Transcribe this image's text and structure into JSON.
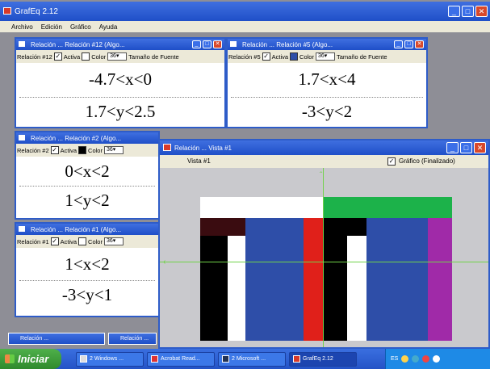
{
  "app": {
    "title": "GrafEq 2.12",
    "menu": [
      "Archivo",
      "Edición",
      "Gráfico",
      "Ayuda"
    ]
  },
  "relation_windows": [
    {
      "title": "Relación ... Relación #12 (Algo...",
      "relation": "Relación #12",
      "active_label": "Activa",
      "color_label": "Color",
      "color": "#ffffff",
      "size": "36",
      "size_label": "Tamaño de Fuente",
      "lines": [
        "-4.7<x<0",
        "1.7<y<2.5"
      ]
    },
    {
      "title": "Relación ... Relación #5 (Algo...",
      "relation": "Relación #5",
      "active_label": "Activa",
      "color_label": "Color",
      "color": "#2e4ea8",
      "size": "36",
      "size_label": "Tamaño de Fuente",
      "lines": [
        "1.7<x<4",
        "-3<y<2"
      ]
    },
    {
      "title": "Relación ... Relación #2 (Algo...",
      "relation": "Relación #2",
      "active_label": "Activa",
      "color_label": "Color",
      "color": "#000000",
      "size": "36",
      "size_label": "",
      "lines": [
        "0<x<2",
        "1<y<2"
      ]
    },
    {
      "title": "Relación ... Relación #1 (Algo...",
      "relation": "Relación #1",
      "active_label": "Activa",
      "color_label": "Color",
      "color": "#ffffff",
      "size": "36",
      "size_label": "",
      "lines": [
        "1<x<2",
        "-3<y<1"
      ]
    }
  ],
  "graph_window": {
    "title": "Relación ... Vista #1",
    "view_label": "Vista #1",
    "graph_status": "Gráfico (Finalizado)"
  },
  "minimized": [
    "Relación ...",
    "Relación ..."
  ],
  "taskbar": {
    "start": "Iniciar",
    "tasks": [
      "2 Windows ...",
      "Acrobat Read...",
      "2 Microsoft ...",
      "GrafEq 2.12"
    ],
    "tray_text": "ES"
  },
  "colors": {
    "black": "#000000",
    "white": "#ffffff",
    "blue": "#2e4ea8",
    "red": "#e0201a",
    "green": "#1cb24a",
    "purple": "#a02aa8",
    "darkred": "#3a0c10",
    "axis": "#70d24a"
  }
}
